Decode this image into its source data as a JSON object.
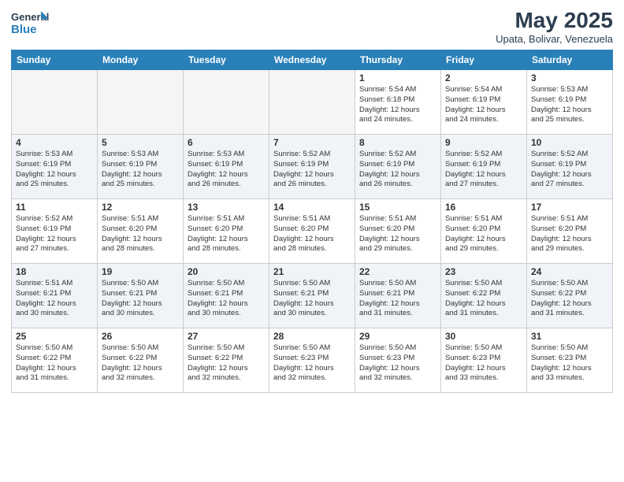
{
  "header": {
    "logo_line1": "General",
    "logo_line2": "Blue",
    "month_year": "May 2025",
    "location": "Upata, Bolivar, Venezuela"
  },
  "weekdays": [
    "Sunday",
    "Monday",
    "Tuesday",
    "Wednesday",
    "Thursday",
    "Friday",
    "Saturday"
  ],
  "weeks": [
    [
      {
        "day": "",
        "content": ""
      },
      {
        "day": "",
        "content": ""
      },
      {
        "day": "",
        "content": ""
      },
      {
        "day": "",
        "content": ""
      },
      {
        "day": "1",
        "content": "Sunrise: 5:54 AM\nSunset: 6:18 PM\nDaylight: 12 hours\nand 24 minutes."
      },
      {
        "day": "2",
        "content": "Sunrise: 5:54 AM\nSunset: 6:19 PM\nDaylight: 12 hours\nand 24 minutes."
      },
      {
        "day": "3",
        "content": "Sunrise: 5:53 AM\nSunset: 6:19 PM\nDaylight: 12 hours\nand 25 minutes."
      }
    ],
    [
      {
        "day": "4",
        "content": "Sunrise: 5:53 AM\nSunset: 6:19 PM\nDaylight: 12 hours\nand 25 minutes."
      },
      {
        "day": "5",
        "content": "Sunrise: 5:53 AM\nSunset: 6:19 PM\nDaylight: 12 hours\nand 25 minutes."
      },
      {
        "day": "6",
        "content": "Sunrise: 5:53 AM\nSunset: 6:19 PM\nDaylight: 12 hours\nand 26 minutes."
      },
      {
        "day": "7",
        "content": "Sunrise: 5:52 AM\nSunset: 6:19 PM\nDaylight: 12 hours\nand 26 minutes."
      },
      {
        "day": "8",
        "content": "Sunrise: 5:52 AM\nSunset: 6:19 PM\nDaylight: 12 hours\nand 26 minutes."
      },
      {
        "day": "9",
        "content": "Sunrise: 5:52 AM\nSunset: 6:19 PM\nDaylight: 12 hours\nand 27 minutes."
      },
      {
        "day": "10",
        "content": "Sunrise: 5:52 AM\nSunset: 6:19 PM\nDaylight: 12 hours\nand 27 minutes."
      }
    ],
    [
      {
        "day": "11",
        "content": "Sunrise: 5:52 AM\nSunset: 6:19 PM\nDaylight: 12 hours\nand 27 minutes."
      },
      {
        "day": "12",
        "content": "Sunrise: 5:51 AM\nSunset: 6:20 PM\nDaylight: 12 hours\nand 28 minutes."
      },
      {
        "day": "13",
        "content": "Sunrise: 5:51 AM\nSunset: 6:20 PM\nDaylight: 12 hours\nand 28 minutes."
      },
      {
        "day": "14",
        "content": "Sunrise: 5:51 AM\nSunset: 6:20 PM\nDaylight: 12 hours\nand 28 minutes."
      },
      {
        "day": "15",
        "content": "Sunrise: 5:51 AM\nSunset: 6:20 PM\nDaylight: 12 hours\nand 29 minutes."
      },
      {
        "day": "16",
        "content": "Sunrise: 5:51 AM\nSunset: 6:20 PM\nDaylight: 12 hours\nand 29 minutes."
      },
      {
        "day": "17",
        "content": "Sunrise: 5:51 AM\nSunset: 6:20 PM\nDaylight: 12 hours\nand 29 minutes."
      }
    ],
    [
      {
        "day": "18",
        "content": "Sunrise: 5:51 AM\nSunset: 6:21 PM\nDaylight: 12 hours\nand 30 minutes."
      },
      {
        "day": "19",
        "content": "Sunrise: 5:50 AM\nSunset: 6:21 PM\nDaylight: 12 hours\nand 30 minutes."
      },
      {
        "day": "20",
        "content": "Sunrise: 5:50 AM\nSunset: 6:21 PM\nDaylight: 12 hours\nand 30 minutes."
      },
      {
        "day": "21",
        "content": "Sunrise: 5:50 AM\nSunset: 6:21 PM\nDaylight: 12 hours\nand 30 minutes."
      },
      {
        "day": "22",
        "content": "Sunrise: 5:50 AM\nSunset: 6:21 PM\nDaylight: 12 hours\nand 31 minutes."
      },
      {
        "day": "23",
        "content": "Sunrise: 5:50 AM\nSunset: 6:22 PM\nDaylight: 12 hours\nand 31 minutes."
      },
      {
        "day": "24",
        "content": "Sunrise: 5:50 AM\nSunset: 6:22 PM\nDaylight: 12 hours\nand 31 minutes."
      }
    ],
    [
      {
        "day": "25",
        "content": "Sunrise: 5:50 AM\nSunset: 6:22 PM\nDaylight: 12 hours\nand 31 minutes."
      },
      {
        "day": "26",
        "content": "Sunrise: 5:50 AM\nSunset: 6:22 PM\nDaylight: 12 hours\nand 32 minutes."
      },
      {
        "day": "27",
        "content": "Sunrise: 5:50 AM\nSunset: 6:22 PM\nDaylight: 12 hours\nand 32 minutes."
      },
      {
        "day": "28",
        "content": "Sunrise: 5:50 AM\nSunset: 6:23 PM\nDaylight: 12 hours\nand 32 minutes."
      },
      {
        "day": "29",
        "content": "Sunrise: 5:50 AM\nSunset: 6:23 PM\nDaylight: 12 hours\nand 32 minutes."
      },
      {
        "day": "30",
        "content": "Sunrise: 5:50 AM\nSunset: 6:23 PM\nDaylight: 12 hours\nand 33 minutes."
      },
      {
        "day": "31",
        "content": "Sunrise: 5:50 AM\nSunset: 6:23 PM\nDaylight: 12 hours\nand 33 minutes."
      }
    ]
  ]
}
